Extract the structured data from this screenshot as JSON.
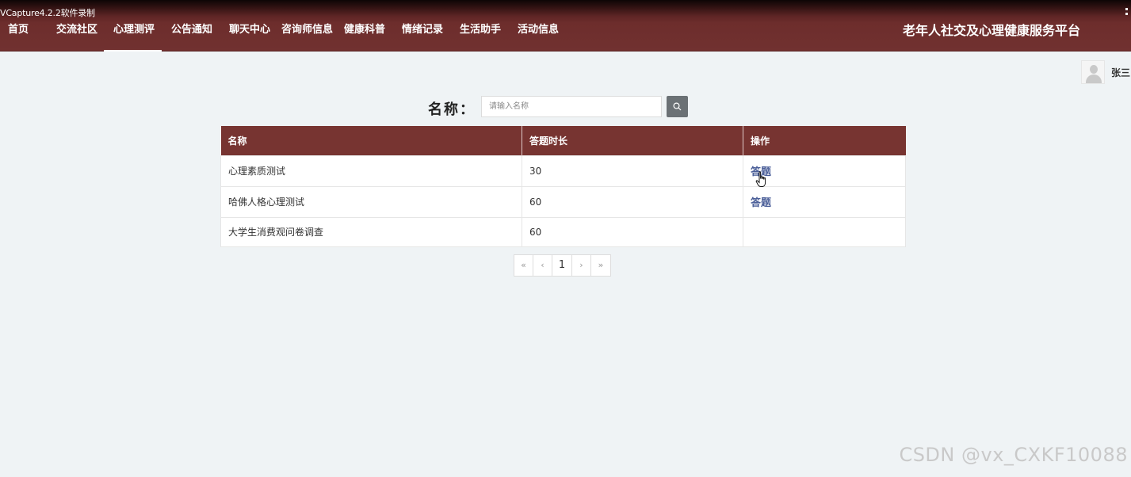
{
  "recorder": {
    "label": "VCapture4.2.2软件录制"
  },
  "nav": {
    "items": [
      {
        "label": "首页"
      },
      {
        "label": "交流社区"
      },
      {
        "label": "心理测评"
      },
      {
        "label": "公告通知"
      },
      {
        "label": "聊天中心"
      },
      {
        "label": "咨询师信息"
      },
      {
        "label": "健康科普"
      },
      {
        "label": "情绪记录"
      },
      {
        "label": "生活助手"
      },
      {
        "label": "活动信息"
      }
    ],
    "active_index": 2,
    "platform_title": "老年人社交及心理健康服务平台"
  },
  "user": {
    "name": "张三",
    "avatar_icon": "user-avatar-icon"
  },
  "search": {
    "label": "名称：",
    "placeholder": "请输入名称",
    "button_icon": "search-icon"
  },
  "table": {
    "headers": [
      "名称",
      "答题时长",
      "操作"
    ],
    "rows": [
      {
        "name": "心理素质测试",
        "duration": "30",
        "action": "答题"
      },
      {
        "name": "哈佛人格心理测试",
        "duration": "60",
        "action": "答题"
      },
      {
        "name": "大学生消费观问卷调查",
        "duration": "60",
        "action": ""
      }
    ]
  },
  "pagination": {
    "first": "«",
    "prev": "‹",
    "current": "1",
    "next": "›",
    "last": "»"
  },
  "watermark": "CSDN @vx_CXKF10088",
  "colors": {
    "nav_bg": "#713130",
    "header_bg": "#773431",
    "link": "#4a5e98",
    "page_bg": "#eff3f5"
  }
}
